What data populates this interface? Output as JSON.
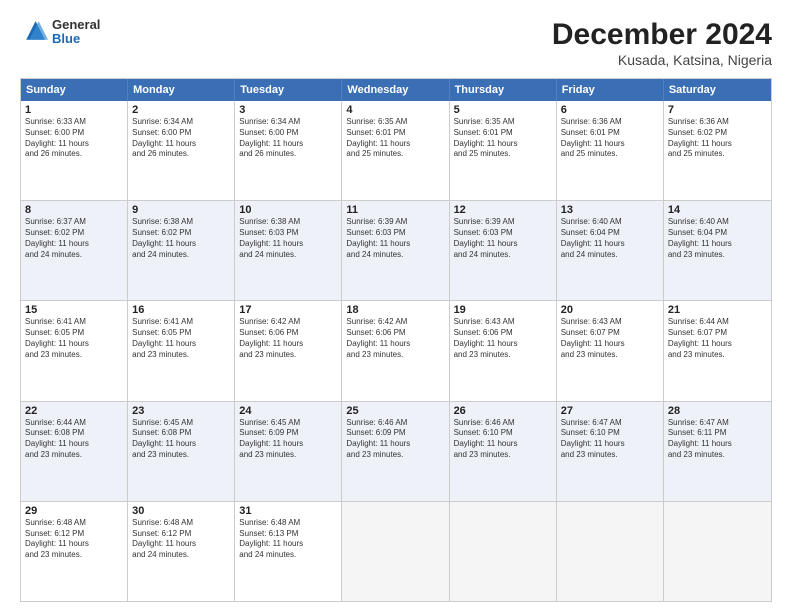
{
  "logo": {
    "general": "General",
    "blue": "Blue"
  },
  "title": "December 2024",
  "subtitle": "Kusada, Katsina, Nigeria",
  "days": [
    "Sunday",
    "Monday",
    "Tuesday",
    "Wednesday",
    "Thursday",
    "Friday",
    "Saturday"
  ],
  "weeks": [
    [
      {
        "day": 1,
        "lines": [
          "Sunrise: 6:33 AM",
          "Sunset: 6:00 PM",
          "Daylight: 11 hours",
          "and 26 minutes."
        ]
      },
      {
        "day": 2,
        "lines": [
          "Sunrise: 6:34 AM",
          "Sunset: 6:00 PM",
          "Daylight: 11 hours",
          "and 26 minutes."
        ]
      },
      {
        "day": 3,
        "lines": [
          "Sunrise: 6:34 AM",
          "Sunset: 6:00 PM",
          "Daylight: 11 hours",
          "and 26 minutes."
        ]
      },
      {
        "day": 4,
        "lines": [
          "Sunrise: 6:35 AM",
          "Sunset: 6:01 PM",
          "Daylight: 11 hours",
          "and 25 minutes."
        ]
      },
      {
        "day": 5,
        "lines": [
          "Sunrise: 6:35 AM",
          "Sunset: 6:01 PM",
          "Daylight: 11 hours",
          "and 25 minutes."
        ]
      },
      {
        "day": 6,
        "lines": [
          "Sunrise: 6:36 AM",
          "Sunset: 6:01 PM",
          "Daylight: 11 hours",
          "and 25 minutes."
        ]
      },
      {
        "day": 7,
        "lines": [
          "Sunrise: 6:36 AM",
          "Sunset: 6:02 PM",
          "Daylight: 11 hours",
          "and 25 minutes."
        ]
      }
    ],
    [
      {
        "day": 8,
        "lines": [
          "Sunrise: 6:37 AM",
          "Sunset: 6:02 PM",
          "Daylight: 11 hours",
          "and 24 minutes."
        ]
      },
      {
        "day": 9,
        "lines": [
          "Sunrise: 6:38 AM",
          "Sunset: 6:02 PM",
          "Daylight: 11 hours",
          "and 24 minutes."
        ]
      },
      {
        "day": 10,
        "lines": [
          "Sunrise: 6:38 AM",
          "Sunset: 6:03 PM",
          "Daylight: 11 hours",
          "and 24 minutes."
        ]
      },
      {
        "day": 11,
        "lines": [
          "Sunrise: 6:39 AM",
          "Sunset: 6:03 PM",
          "Daylight: 11 hours",
          "and 24 minutes."
        ]
      },
      {
        "day": 12,
        "lines": [
          "Sunrise: 6:39 AM",
          "Sunset: 6:03 PM",
          "Daylight: 11 hours",
          "and 24 minutes."
        ]
      },
      {
        "day": 13,
        "lines": [
          "Sunrise: 6:40 AM",
          "Sunset: 6:04 PM",
          "Daylight: 11 hours",
          "and 24 minutes."
        ]
      },
      {
        "day": 14,
        "lines": [
          "Sunrise: 6:40 AM",
          "Sunset: 6:04 PM",
          "Daylight: 11 hours",
          "and 23 minutes."
        ]
      }
    ],
    [
      {
        "day": 15,
        "lines": [
          "Sunrise: 6:41 AM",
          "Sunset: 6:05 PM",
          "Daylight: 11 hours",
          "and 23 minutes."
        ]
      },
      {
        "day": 16,
        "lines": [
          "Sunrise: 6:41 AM",
          "Sunset: 6:05 PM",
          "Daylight: 11 hours",
          "and 23 minutes."
        ]
      },
      {
        "day": 17,
        "lines": [
          "Sunrise: 6:42 AM",
          "Sunset: 6:06 PM",
          "Daylight: 11 hours",
          "and 23 minutes."
        ]
      },
      {
        "day": 18,
        "lines": [
          "Sunrise: 6:42 AM",
          "Sunset: 6:06 PM",
          "Daylight: 11 hours",
          "and 23 minutes."
        ]
      },
      {
        "day": 19,
        "lines": [
          "Sunrise: 6:43 AM",
          "Sunset: 6:06 PM",
          "Daylight: 11 hours",
          "and 23 minutes."
        ]
      },
      {
        "day": 20,
        "lines": [
          "Sunrise: 6:43 AM",
          "Sunset: 6:07 PM",
          "Daylight: 11 hours",
          "and 23 minutes."
        ]
      },
      {
        "day": 21,
        "lines": [
          "Sunrise: 6:44 AM",
          "Sunset: 6:07 PM",
          "Daylight: 11 hours",
          "and 23 minutes."
        ]
      }
    ],
    [
      {
        "day": 22,
        "lines": [
          "Sunrise: 6:44 AM",
          "Sunset: 6:08 PM",
          "Daylight: 11 hours",
          "and 23 minutes."
        ]
      },
      {
        "day": 23,
        "lines": [
          "Sunrise: 6:45 AM",
          "Sunset: 6:08 PM",
          "Daylight: 11 hours",
          "and 23 minutes."
        ]
      },
      {
        "day": 24,
        "lines": [
          "Sunrise: 6:45 AM",
          "Sunset: 6:09 PM",
          "Daylight: 11 hours",
          "and 23 minutes."
        ]
      },
      {
        "day": 25,
        "lines": [
          "Sunrise: 6:46 AM",
          "Sunset: 6:09 PM",
          "Daylight: 11 hours",
          "and 23 minutes."
        ]
      },
      {
        "day": 26,
        "lines": [
          "Sunrise: 6:46 AM",
          "Sunset: 6:10 PM",
          "Daylight: 11 hours",
          "and 23 minutes."
        ]
      },
      {
        "day": 27,
        "lines": [
          "Sunrise: 6:47 AM",
          "Sunset: 6:10 PM",
          "Daylight: 11 hours",
          "and 23 minutes."
        ]
      },
      {
        "day": 28,
        "lines": [
          "Sunrise: 6:47 AM",
          "Sunset: 6:11 PM",
          "Daylight: 11 hours",
          "and 23 minutes."
        ]
      }
    ],
    [
      {
        "day": 29,
        "lines": [
          "Sunrise: 6:48 AM",
          "Sunset: 6:12 PM",
          "Daylight: 11 hours",
          "and 23 minutes."
        ]
      },
      {
        "day": 30,
        "lines": [
          "Sunrise: 6:48 AM",
          "Sunset: 6:12 PM",
          "Daylight: 11 hours",
          "and 24 minutes."
        ]
      },
      {
        "day": 31,
        "lines": [
          "Sunrise: 6:48 AM",
          "Sunset: 6:13 PM",
          "Daylight: 11 hours",
          "and 24 minutes."
        ]
      },
      null,
      null,
      null,
      null
    ]
  ]
}
